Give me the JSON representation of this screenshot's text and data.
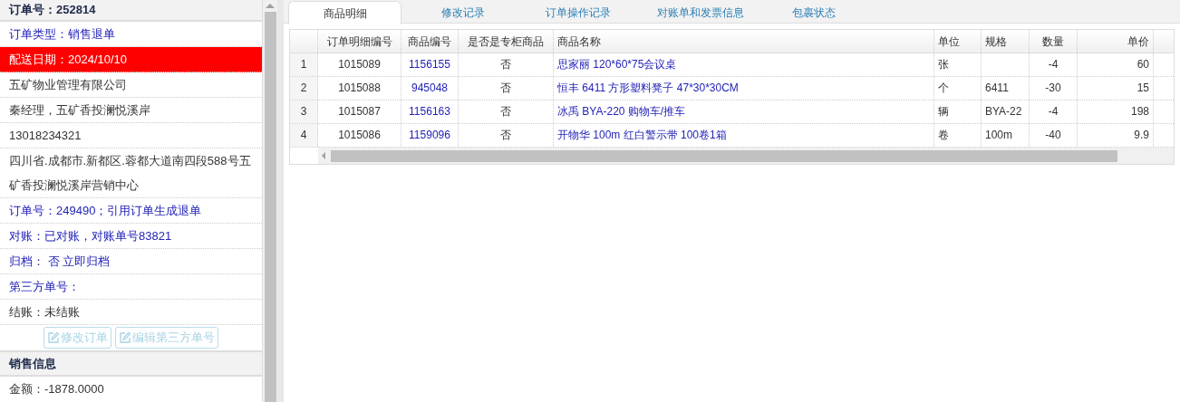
{
  "order_panel": {
    "title": "订单号：252814",
    "rows": [
      {
        "text": "订单类型：销售退单",
        "kind": "link"
      },
      {
        "text": "配送日期：2024/10/10",
        "kind": "highlight"
      },
      {
        "text": "五矿物业管理有限公司",
        "kind": "plain"
      },
      {
        "text": "秦经理，五矿香投澜悦溪岸",
        "kind": "plain"
      },
      {
        "text": "13018234321",
        "kind": "plain"
      },
      {
        "text": "四川省.成都市.新都区.蓉都大道南四段588号五矿香投澜悦溪岸营销中心",
        "kind": "plain"
      },
      {
        "text": "订单号：249490；引用订单生成退单",
        "kind": "link"
      },
      {
        "text": "对账：已对账，对账单号83821",
        "kind": "link"
      },
      {
        "text": "归档： 否 立即归档",
        "kind": "link"
      },
      {
        "text": "第三方单号：",
        "kind": "link"
      },
      {
        "text": "结账：未结账",
        "kind": "plain"
      }
    ],
    "buttons": [
      {
        "label": "修改订单",
        "disabled": true
      },
      {
        "label": "编辑第三方单号",
        "disabled": true
      }
    ]
  },
  "sales_panel": {
    "title": "销售信息",
    "rows": [
      "金额：-1878.0000"
    ]
  },
  "tabs": [
    {
      "label": "商品明细",
      "selected": true
    },
    {
      "label": "修改记录",
      "selected": false
    },
    {
      "label": "订单操作记录",
      "selected": false
    },
    {
      "label": "对账单和发票信息",
      "selected": false
    },
    {
      "label": "包裹状态",
      "selected": false
    }
  ],
  "table": {
    "columns": [
      "",
      "订单明细编号",
      "商品编号",
      "是否是专柜商品",
      "商品名称",
      "单位",
      "规格",
      "数量",
      "单价"
    ],
    "rows": [
      [
        "1",
        "1015089",
        "1156155",
        "否",
        "思家丽 120*60*75会议桌",
        "张",
        "",
        "-4",
        "60"
      ],
      [
        "2",
        "1015088",
        "945048",
        "否",
        "恒丰 6411 方形塑料凳子 47*30*30CM",
        "个",
        "6411",
        "-30",
        "15"
      ],
      [
        "3",
        "1015087",
        "1156163",
        "否",
        "冰禹 BYA-220 购物车/推车",
        "辆",
        "BYA-22",
        "-4",
        "198"
      ],
      [
        "4",
        "1015086",
        "1159096",
        "否",
        "开物华 100m 红白警示带 100卷1箱",
        "卷",
        "100m",
        "-40",
        "9.9"
      ]
    ]
  }
}
